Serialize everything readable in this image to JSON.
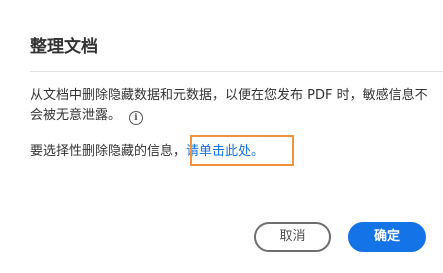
{
  "dialog": {
    "title": "整理文档",
    "description": "从文档中删除隐藏数据和元数据，以便在您发布 PDF 时，敏感信息不会被无意泄露。",
    "info_icon_glyph": "i",
    "remove_hidden_prefix": "要选择性删除隐藏的信息，",
    "remove_hidden_link": "请单击此处。"
  },
  "buttons": {
    "cancel_label": "取消",
    "ok_label": "确定"
  },
  "colors": {
    "link": "#1473e6",
    "primary_button": "#1473e6",
    "highlight_border": "#f0923e"
  }
}
